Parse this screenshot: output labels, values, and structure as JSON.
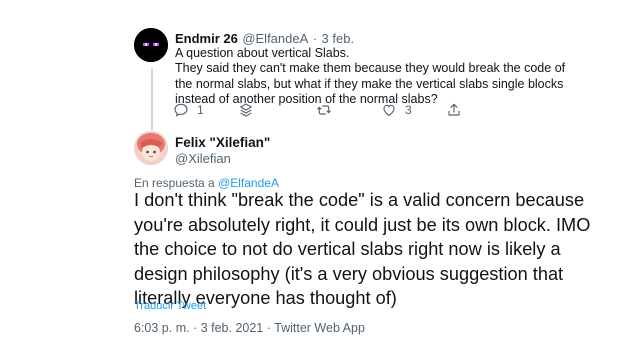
{
  "reply_tweet": {
    "author_name": "Endmir 26",
    "author_handle": "@ElfandeA",
    "separator": "·",
    "date": "3 feb.",
    "text_lines": [
      "A question about vertical Slabs.",
      "They said they can't make them because they would break the code of",
      "the normal slabs, but what if they make the vertical slabs single blocks",
      "instead of another position of the normal slabs?"
    ],
    "reply_count": "1",
    "like_count": "3",
    "icons": [
      "reply-icon",
      "more-icon",
      "retweet-icon",
      "like-icon",
      "share-icon"
    ]
  },
  "main_tweet": {
    "author_name": "Felix \"Xilefian\"",
    "author_handle": "@Xilefian",
    "in_reply_prefix": "En respuesta a",
    "in_reply_handle": "@ElfandeA",
    "text_lines": [
      "I don't think \"break the code\" is a valid concern because",
      "you're absolutely right, it could just be its own block. IMO",
      "the choice to not do vertical slabs right now is likely a",
      "design philosophy (it's a very obvious suggestion that",
      "literally everyone has thought of)"
    ],
    "translate_label": "Traducir Tweet",
    "timestamp": "6:03 p. m. · 3 feb. 2021 · Twitter Web App"
  },
  "colors": {
    "link": "#1d9bf0",
    "secondary_text": "#536471",
    "thread_line": "#cfd9de"
  }
}
